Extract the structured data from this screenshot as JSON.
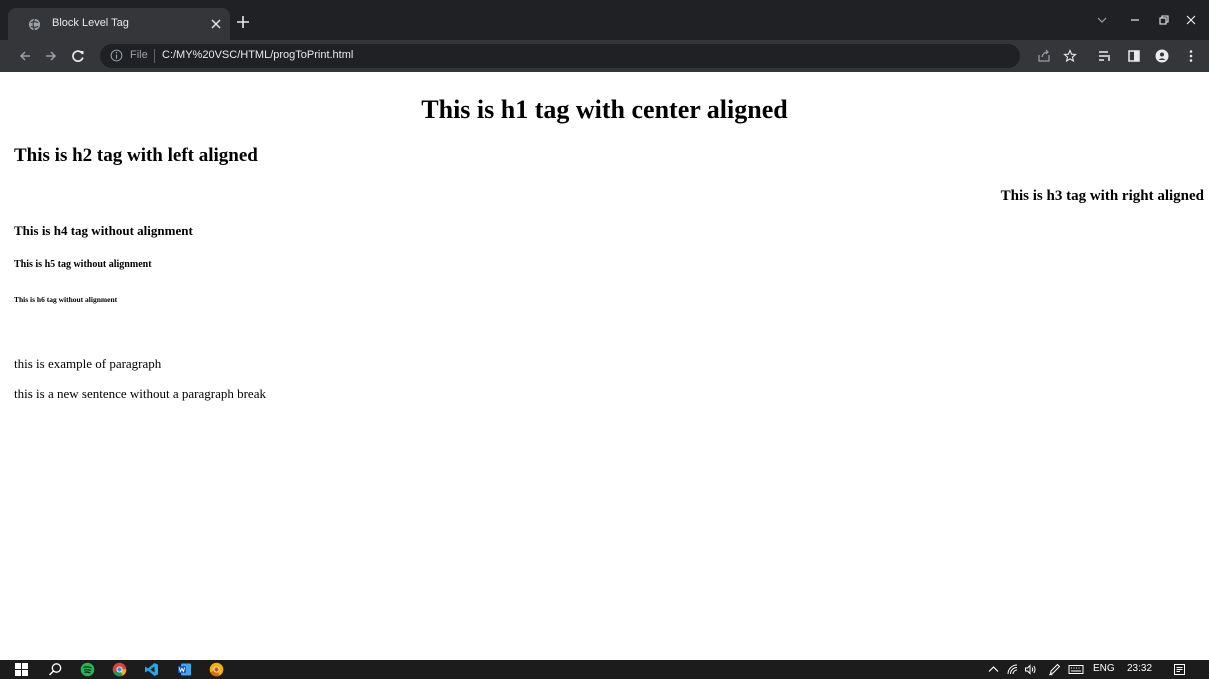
{
  "tab": {
    "title": "Block Level Tag"
  },
  "omnibox": {
    "scheme_label": "File",
    "url": "C:/MY%20VSC/HTML/progToPrint.html"
  },
  "page": {
    "h1": "This is h1 tag with center aligned",
    "h2": "This is h2 tag with left aligned",
    "h3": "This is h3 tag with right aligned",
    "h4": "This is h4 tag without alignment",
    "h5": "This is h5 tag without alignment",
    "h6": "This is h6 tag without alignment",
    "paragraph": "this is example of paragraph",
    "line_after_break": "this is a new sentence without a paragraph break"
  },
  "taskbar": {
    "language": "ENG",
    "time": "23:32",
    "apps": [
      "windows-start-icon",
      "search-icon",
      "spotify-icon",
      "chrome-icon",
      "vscode-icon",
      "word-icon",
      "chrome-canary-icon"
    ]
  },
  "colors": {
    "titlebar": "#202124",
    "toolbar": "#35363a",
    "taskbar": "#1c1c1c",
    "page_background": "#ffffff",
    "text": "#000000"
  }
}
